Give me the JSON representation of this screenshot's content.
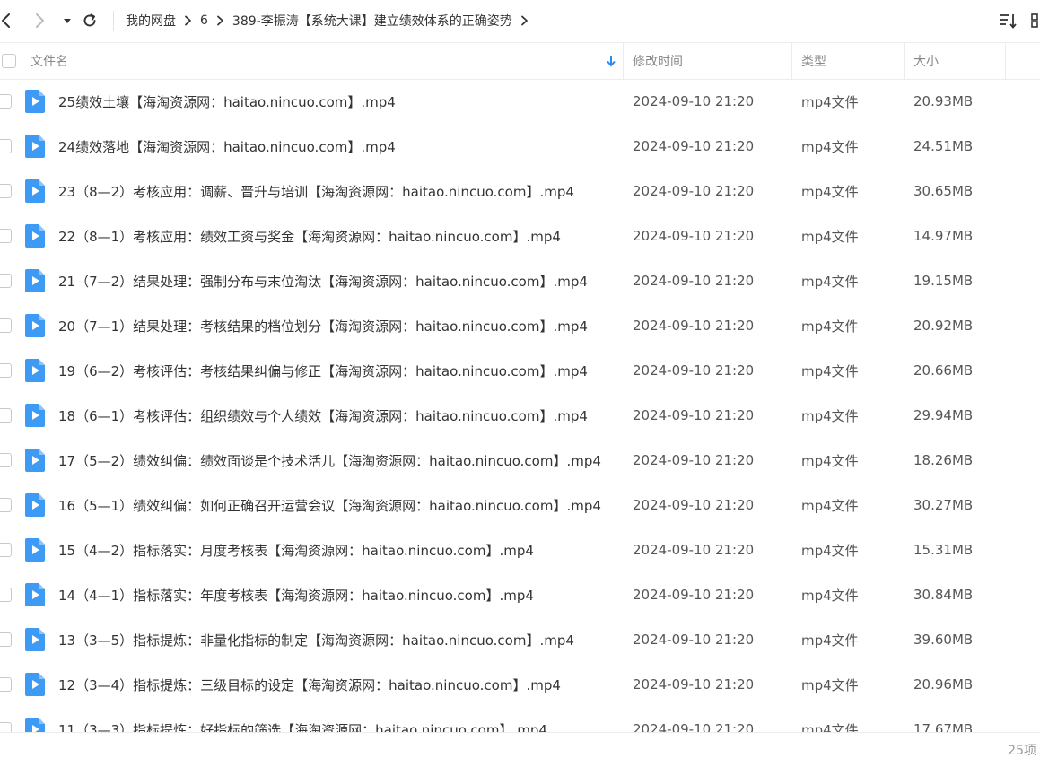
{
  "toolbar": {
    "breadcrumb": [
      "我的网盘",
      "6",
      "389-李振涛【系统大课】建立绩效体系的正确姿势"
    ]
  },
  "header": {
    "name": "文件名",
    "mtime": "修改时间",
    "type": "类型",
    "size": "大小"
  },
  "files": [
    {
      "name": "25绩效土壤【海淘资源网：haitao.nincuo.com】.mp4",
      "mtime": "2024-09-10 21:20",
      "type": "mp4文件",
      "size": "20.93MB"
    },
    {
      "name": "24绩效落地【海淘资源网：haitao.nincuo.com】.mp4",
      "mtime": "2024-09-10 21:20",
      "type": "mp4文件",
      "size": "24.51MB"
    },
    {
      "name": "23（8—2）考核应用：调薪、晋升与培训【海淘资源网：haitao.nincuo.com】.mp4",
      "mtime": "2024-09-10 21:20",
      "type": "mp4文件",
      "size": "30.65MB"
    },
    {
      "name": "22（8—1）考核应用：绩效工资与奖金【海淘资源网：haitao.nincuo.com】.mp4",
      "mtime": "2024-09-10 21:20",
      "type": "mp4文件",
      "size": "14.97MB"
    },
    {
      "name": "21（7—2）结果处理：强制分布与末位淘汰【海淘资源网：haitao.nincuo.com】.mp4",
      "mtime": "2024-09-10 21:20",
      "type": "mp4文件",
      "size": "19.15MB"
    },
    {
      "name": "20（7—1）结果处理：考核结果的档位划分【海淘资源网：haitao.nincuo.com】.mp4",
      "mtime": "2024-09-10 21:20",
      "type": "mp4文件",
      "size": "20.92MB"
    },
    {
      "name": "19（6—2）考核评估：考核结果纠偏与修正【海淘资源网：haitao.nincuo.com】.mp4",
      "mtime": "2024-09-10 21:20",
      "type": "mp4文件",
      "size": "20.66MB"
    },
    {
      "name": "18（6—1）考核评估：组织绩效与个人绩效【海淘资源网：haitao.nincuo.com】.mp4",
      "mtime": "2024-09-10 21:20",
      "type": "mp4文件",
      "size": "29.94MB"
    },
    {
      "name": "17（5—2）绩效纠偏：绩效面谈是个技术活儿【海淘资源网：haitao.nincuo.com】.mp4",
      "mtime": "2024-09-10 21:20",
      "type": "mp4文件",
      "size": "18.26MB"
    },
    {
      "name": "16（5—1）绩效纠偏：如何正确召开运营会议【海淘资源网：haitao.nincuo.com】.mp4",
      "mtime": "2024-09-10 21:20",
      "type": "mp4文件",
      "size": "30.27MB"
    },
    {
      "name": "15（4—2）指标落实：月度考核表【海淘资源网：haitao.nincuo.com】.mp4",
      "mtime": "2024-09-10 21:20",
      "type": "mp4文件",
      "size": "15.31MB"
    },
    {
      "name": "14（4—1）指标落实：年度考核表【海淘资源网：haitao.nincuo.com】.mp4",
      "mtime": "2024-09-10 21:20",
      "type": "mp4文件",
      "size": "30.84MB"
    },
    {
      "name": "13（3—5）指标提炼：非量化指标的制定【海淘资源网：haitao.nincuo.com】.mp4",
      "mtime": "2024-09-10 21:20",
      "type": "mp4文件",
      "size": "39.60MB"
    },
    {
      "name": "12（3—4）指标提炼：三级目标的设定【海淘资源网：haitao.nincuo.com】.mp4",
      "mtime": "2024-09-10 21:20",
      "type": "mp4文件",
      "size": "20.96MB"
    },
    {
      "name": "11（3—3）指标提炼：好指标的筛选【海淘资源网：haitao.nincuo.com】.mp4",
      "mtime": "2024-09-10 21:20",
      "type": "mp4文件",
      "size": "17.67MB"
    }
  ],
  "footer": {
    "count": "25项"
  },
  "colors": {
    "accent": "#2b8cf3",
    "file_icon": "#3d9bf5"
  },
  "icons": {
    "back": "chevron-left-icon",
    "forward": "chevron-right-icon",
    "history": "caret-down-icon",
    "refresh": "refresh-icon",
    "sort": "sort-list-icon",
    "view": "grid-view-icon",
    "sort_direction": "arrow-down-icon",
    "file": "video-file-icon"
  }
}
